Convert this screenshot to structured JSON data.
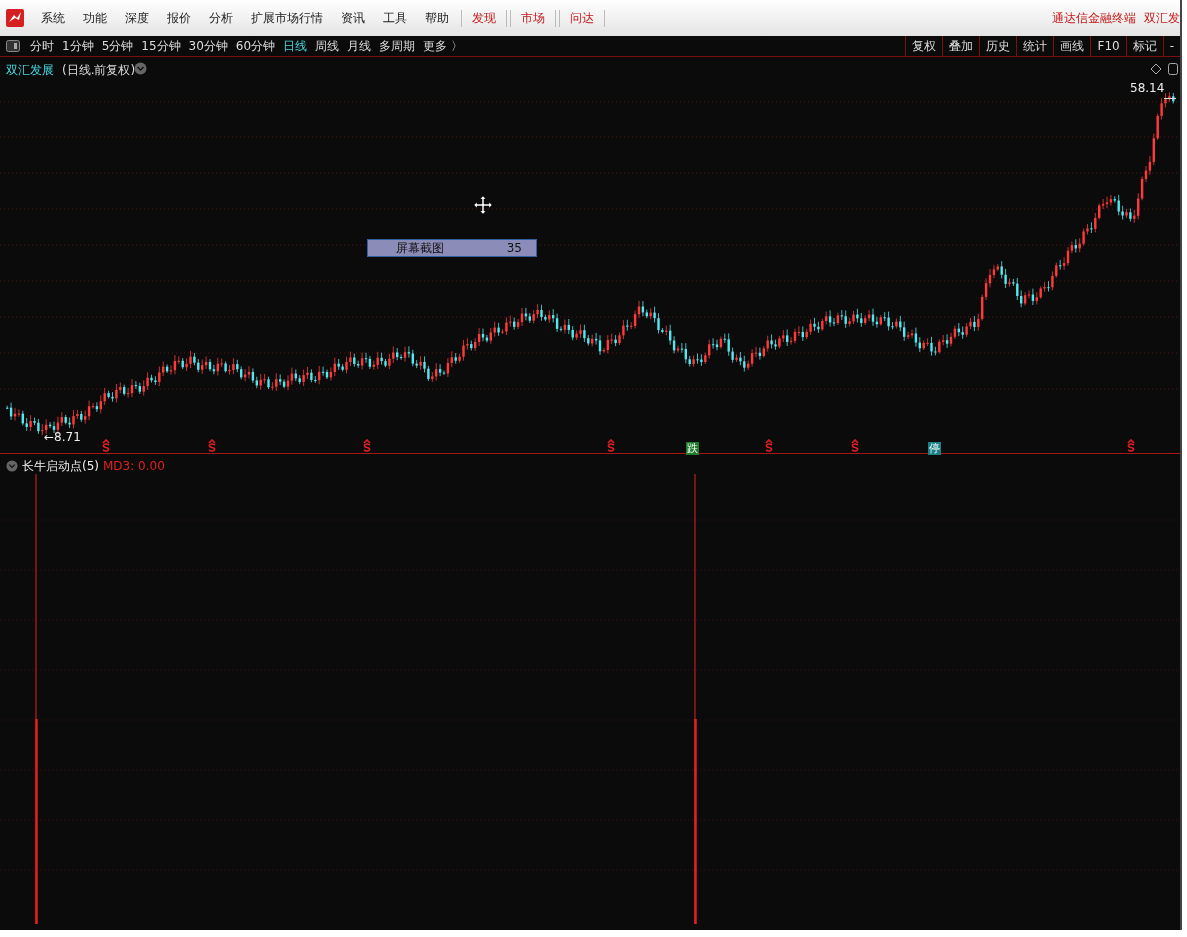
{
  "menu_bar": {
    "items": [
      "系统",
      "功能",
      "深度",
      "报价",
      "分析",
      "扩展市场行情",
      "资讯",
      "工具",
      "帮助"
    ],
    "highlight_items": [
      "发现",
      "市场",
      "问达"
    ],
    "right_texts": [
      "通达信金融终端",
      "双汇发"
    ]
  },
  "period_bar": {
    "items": [
      {
        "label": "分时",
        "selected": false
      },
      {
        "label": "1分钟",
        "selected": false
      },
      {
        "label": "5分钟",
        "selected": false
      },
      {
        "label": "15分钟",
        "selected": false
      },
      {
        "label": "30分钟",
        "selected": false
      },
      {
        "label": "60分钟",
        "selected": false
      },
      {
        "label": "日线",
        "selected": true
      },
      {
        "label": "周线",
        "selected": false
      },
      {
        "label": "月线",
        "selected": false
      },
      {
        "label": "多周期",
        "selected": false
      },
      {
        "label": "更多 〉",
        "selected": false
      }
    ],
    "tools": [
      "复权",
      "叠加",
      "历史",
      "统计",
      "画线",
      "F10",
      "标记",
      "-"
    ]
  },
  "main_chart": {
    "stock_name": "双汇发展",
    "subtitle": "(日线.前复权)",
    "high_label": "58.14",
    "low_label": "←8.71",
    "markers": [
      {
        "kind": "signal"
      },
      {
        "kind": "signal"
      },
      {
        "kind": "signal"
      },
      {
        "kind": "signal"
      },
      {
        "kind": "tag",
        "text": "跌",
        "color": "#1f7a2a"
      },
      {
        "kind": "signal"
      },
      {
        "kind": "signal"
      },
      {
        "kind": "tag",
        "text": "停",
        "color": "#1a7f86"
      },
      {
        "kind": "signal"
      }
    ]
  },
  "tooltip": {
    "label": "屏幕截图",
    "value": "35"
  },
  "indicator": {
    "name": "长牛启动点(5)",
    "reading": "MD3: 0.00"
  }
}
